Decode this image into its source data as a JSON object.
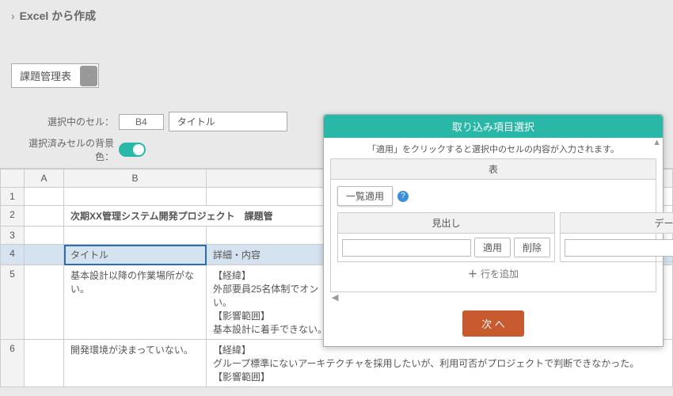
{
  "header": {
    "title": "Excel から作成"
  },
  "tableType": {
    "selected": "課題管理表"
  },
  "controls": {
    "cellLabel": "選択中のセル：",
    "cellRef": "B4",
    "cellValue": "タイトル",
    "bgLabel": "選択済みセルの背景色："
  },
  "grid": {
    "cols": [
      "A",
      "B",
      ""
    ],
    "rows": [
      {
        "num": "1",
        "a": "",
        "b": "",
        "c": ""
      },
      {
        "num": "2",
        "a": "",
        "b": "次期XX管理システム開発プロジェクト　課題管",
        "c": "",
        "bold": true,
        "span": true
      },
      {
        "num": "3",
        "a": "",
        "b": "",
        "c": ""
      },
      {
        "num": "4",
        "a": "",
        "b": "タイトル",
        "c": "詳細・内容",
        "selected": true,
        "active": true
      },
      {
        "num": "5",
        "a": "",
        "b": "基本設計以降の作業場所がない。",
        "c": "【経緯】\n外部要員25名体制でオン\nい。\n【影響範囲】\n基本設計に着手できない。"
      },
      {
        "num": "6",
        "a": "",
        "b": "開発環境が決まっていない。",
        "c": "【経緯】\nグループ標準にないアーキテクチャを採用したいが、利用可否がプロジェクトで判断できなかった。\n【影響範囲】"
      }
    ]
  },
  "panel": {
    "title": "取り込み項目選択",
    "hint": "「適用」をクリックすると選択中のセルの内容が入力されます。",
    "tableLabel": "表",
    "listApply": "一覧適用",
    "heading": "見出し",
    "data": "データ",
    "apply": "適用",
    "delete": "削除",
    "addRow": "行を追加",
    "next": "次 へ"
  }
}
